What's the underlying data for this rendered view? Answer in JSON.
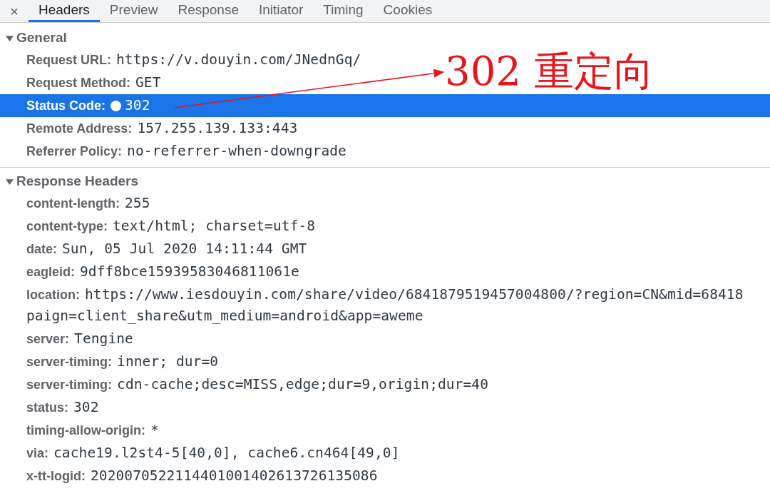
{
  "tabs_bar": {
    "close": "×",
    "tabs": [
      {
        "label": "Headers",
        "selected": true
      },
      {
        "label": "Preview",
        "selected": false
      },
      {
        "label": "Response",
        "selected": false
      },
      {
        "label": "Initiator",
        "selected": false
      },
      {
        "label": "Timing",
        "selected": false
      },
      {
        "label": "Cookies",
        "selected": false
      }
    ]
  },
  "sections": [
    {
      "title": "General",
      "expanded": true,
      "rows": [
        {
          "name": "Request URL:",
          "value_lines": [
            "https://v.douyin.com/JNednGq/"
          ],
          "selected": false
        },
        {
          "name": "Request Method:",
          "value_lines": [
            "GET"
          ],
          "selected": false
        },
        {
          "name": "Status Code:",
          "value_lines": [
            "302"
          ],
          "status_dot": true,
          "selected": true
        },
        {
          "name": "Remote Address:",
          "value_lines": [
            "157.255.139.133:443"
          ],
          "selected": false
        },
        {
          "name": "Referrer Policy:",
          "value_lines": [
            "no-referrer-when-downgrade"
          ],
          "selected": false
        }
      ]
    },
    {
      "title": "Response Headers",
      "expanded": true,
      "rows": [
        {
          "name": "content-length:",
          "value_lines": [
            "255"
          ],
          "selected": false
        },
        {
          "name": "content-type:",
          "value_lines": [
            "text/html; charset=utf-8"
          ],
          "selected": false
        },
        {
          "name": "date:",
          "value_lines": [
            "Sun, 05 Jul 2020 14:11:44 GMT"
          ],
          "selected": false
        },
        {
          "name": "eagleid:",
          "value_lines": [
            "9dff8bce15939583046811061e"
          ],
          "selected": false
        },
        {
          "name": "location:",
          "value_lines": [
            "https://www.iesdouyin.com/share/video/6841879519457004800/?region=CN&mid=68418",
            "paign=client_share&utm_medium=android&app=aweme"
          ],
          "selected": false
        },
        {
          "name": "server:",
          "value_lines": [
            "Tengine"
          ],
          "selected": false
        },
        {
          "name": "server-timing:",
          "value_lines": [
            "inner; dur=0"
          ],
          "selected": false
        },
        {
          "name": "server-timing:",
          "value_lines": [
            "cdn-cache;desc=MISS,edge;dur=9,origin;dur=40"
          ],
          "selected": false
        },
        {
          "name": "status:",
          "value_lines": [
            "302"
          ],
          "selected": false
        },
        {
          "name": "timing-allow-origin:",
          "value_lines": [
            "*"
          ],
          "selected": false
        },
        {
          "name": "via:",
          "value_lines": [
            "cache19.l2st4-5[40,0], cache6.cn464[49,0]"
          ],
          "selected": false
        },
        {
          "name": "x-tt-logid:",
          "value_lines": [
            "2020070522114401001402613726135086"
          ],
          "selected": false
        }
      ]
    }
  ],
  "annotation": {
    "text": "302 重定向"
  }
}
